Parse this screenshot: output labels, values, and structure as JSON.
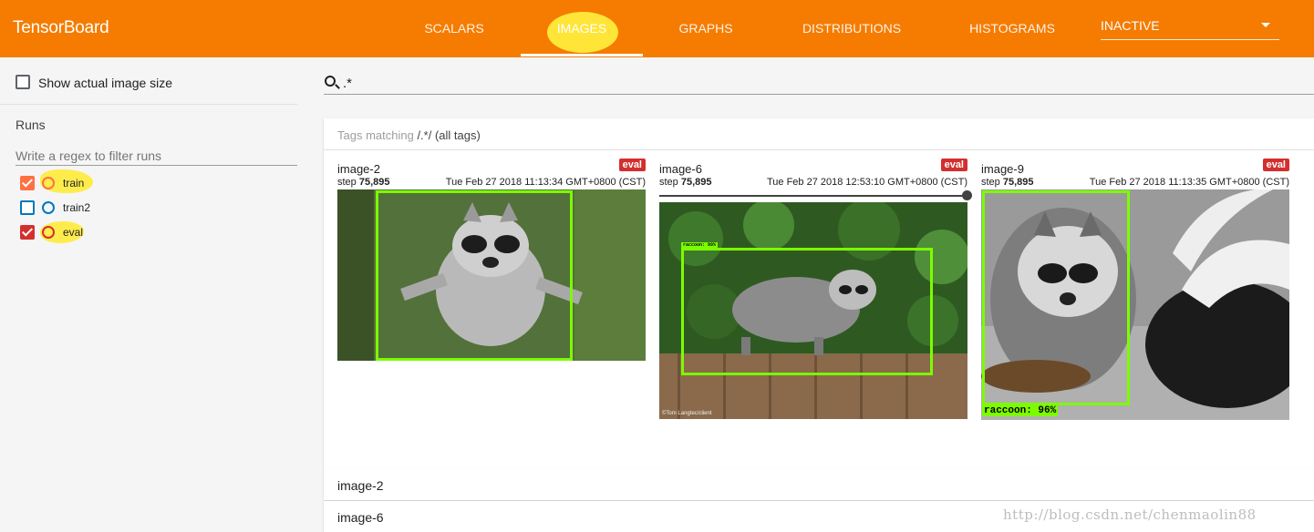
{
  "app": {
    "title": "TensorBoard"
  },
  "tabs": [
    {
      "label": "SCALARS",
      "active": false
    },
    {
      "label": "IMAGES",
      "active": true
    },
    {
      "label": "GRAPHS",
      "active": false
    },
    {
      "label": "DISTRIBUTIONS",
      "active": false
    },
    {
      "label": "HISTOGRAMS",
      "active": false
    }
  ],
  "inactive_dropdown": {
    "selected": "INACTIVE",
    "icon": "chevron-down-icon"
  },
  "sidebar": {
    "show_actual_size_label": "Show actual image size",
    "show_actual_size_checked": false,
    "runs_title": "Runs",
    "filter_placeholder": "Write a regex to filter runs",
    "runs": [
      {
        "label": "train",
        "checked": true,
        "color": "#ff7043",
        "highlighted": true
      },
      {
        "label": "train2",
        "checked": false,
        "color": "#0277bd",
        "highlighted": false
      },
      {
        "label": "eval",
        "checked": true,
        "color": "#d32f2f",
        "highlighted": true
      }
    ]
  },
  "search": {
    "value": ".*",
    "icon": "search-icon"
  },
  "tags_panel": {
    "prefix": "Tags matching ",
    "pattern": "/.*/",
    "suffix": " (all tags)"
  },
  "cards": [
    {
      "title": "image-2",
      "badge": "eval",
      "step_prefix": "step ",
      "step": "75,895",
      "timestamp": "Tue Feb 27 2018 11:13:34 GMT+0800 (CST)",
      "has_slider": false,
      "box_label": ""
    },
    {
      "title": "image-6",
      "badge": "eval",
      "step_prefix": "step ",
      "step": "75,895",
      "timestamp": "Tue Feb 27 2018 12:53:10 GMT+0800 (CST)",
      "has_slider": true,
      "box_label": "raccoon: 99%",
      "photo_credit": "©Tom Langtec/client"
    },
    {
      "title": "image-9",
      "badge": "eval",
      "step_prefix": "step ",
      "step": "75,895",
      "timestamp": "Tue Feb 27 2018 11:13:35 GMT+0800 (CST)",
      "has_slider": false,
      "box_label": "raccoon: 96%"
    }
  ],
  "collapsed_rows": [
    {
      "label": "image-2"
    },
    {
      "label": "image-6"
    }
  ],
  "watermark": "http://blog.csdn.net/chenmaolin88",
  "colors": {
    "header": "#f57c00",
    "badge": "#d32f2f",
    "bbox": "#7cfc00",
    "highlight": "#ffeb3b"
  }
}
